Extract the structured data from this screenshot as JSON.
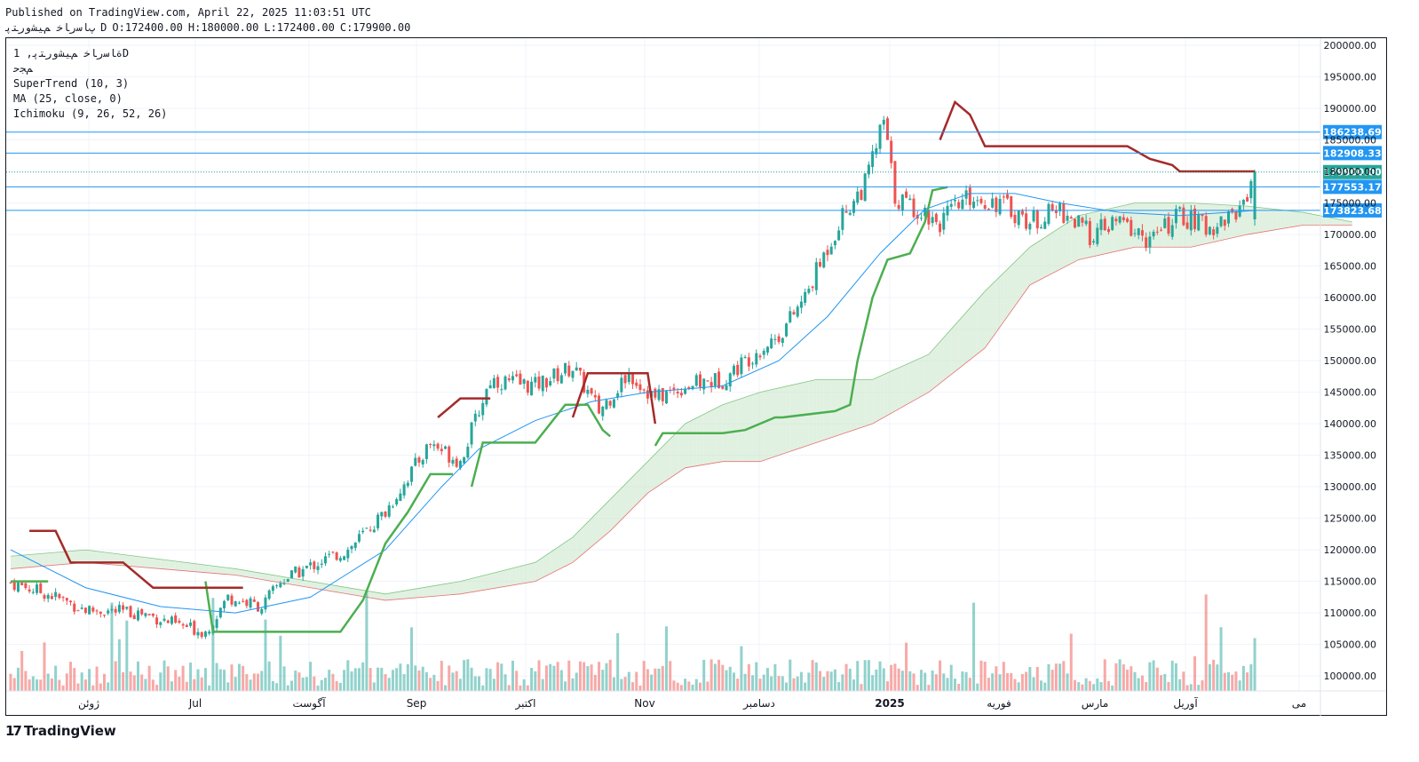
{
  "header": {
    "published": "Published on TradingView.com, April 22, 2025 11:03:51 UTC",
    "symbol": "ﭖﺎﺳﺭﺎﺧ ﻢﯿﺸﻭﺭﺘﭘ",
    "interval": "D",
    "ohlc": {
      "open": "O:172400.00",
      "high": "H:180000.00",
      "low": "L:172400.00",
      "close": "C:179900.00"
    }
  },
  "legend": {
    "title": "ﺓﺎﺳﺭﺎﺧ ﻢﯿﺸﻭﺭﺘﭘ, 1D",
    "subtitle": "ﻢﺠﺣ",
    "indicators": [
      "SuperTrend (10, 3)",
      "MA (25, close, 0)",
      "Ichimoku (9, 26, 52, 26)"
    ]
  },
  "logo": {
    "mark": "17",
    "text": "TradingView"
  },
  "colors": {
    "up": "#26a69a",
    "down": "#ef5350",
    "supertrend_up": "#4caf50",
    "supertrend_down": "#a52a2a",
    "ma": "#2196f3",
    "cloud_bull": "#c8e6c9",
    "cloud_bear": "#ffcdd2",
    "hline": "#2196f3",
    "price_label": "#2196f3",
    "last_price_label": "#26a69a"
  },
  "chart_data": {
    "type": "candlestick",
    "y_axis": {
      "min": 96500,
      "max": 200000,
      "ticks": [
        200000,
        195000,
        190000,
        185000,
        180000,
        175000,
        170000,
        165000,
        160000,
        155000,
        150000,
        145000,
        140000,
        135000,
        130000,
        125000,
        120000,
        115000,
        110000,
        105000,
        100000
      ],
      "tick_labels": [
        "200000.00",
        "195000.00",
        "190000.00",
        "185000.00",
        "180000.00",
        "175000.00",
        "170000.00",
        "165000.00",
        "160000.00",
        "155000.00",
        "150000.00",
        "145000.00",
        "140000.00",
        "135000.00",
        "130000.00",
        "125000.00",
        "120000.00",
        "115000.00",
        "110000.00",
        "105000.00",
        "100000.00"
      ]
    },
    "x_axis": {
      "labels": [
        "ژوئن",
        "Jul",
        "آگوست",
        "Sep",
        "اکتبر",
        "Nov",
        "دسامبر",
        "2025",
        "فوریه",
        "مارس",
        "آوریل",
        "می"
      ]
    },
    "horizontal_lines": [
      {
        "value": 186238.69,
        "label": "186238.69"
      },
      {
        "value": 182908.33,
        "label": "182908.33"
      },
      {
        "value": 177553.17,
        "label": "177553.17"
      },
      {
        "value": 173823.68,
        "label": "173823.68"
      }
    ],
    "last_price": {
      "value": 179900,
      "label": "179900.00"
    },
    "price_anchors": [
      {
        "i": 0,
        "c": 114800
      },
      {
        "i": 10,
        "c": 113000
      },
      {
        "i": 20,
        "c": 110500
      },
      {
        "i": 35,
        "c": 110000
      },
      {
        "i": 45,
        "c": 108000
      },
      {
        "i": 52,
        "c": 107000
      },
      {
        "i": 58,
        "c": 112500
      },
      {
        "i": 67,
        "c": 111000
      },
      {
        "i": 72,
        "c": 115000
      },
      {
        "i": 82,
        "c": 118000
      },
      {
        "i": 90,
        "c": 120000
      },
      {
        "i": 100,
        "c": 126000
      },
      {
        "i": 112,
        "c": 137000
      },
      {
        "i": 120,
        "c": 134000
      },
      {
        "i": 128,
        "c": 147000
      },
      {
        "i": 140,
        "c": 146000
      },
      {
        "i": 150,
        "c": 149000
      },
      {
        "i": 157,
        "c": 142000
      },
      {
        "i": 165,
        "c": 148000
      },
      {
        "i": 172,
        "c": 144000
      },
      {
        "i": 180,
        "c": 146000
      },
      {
        "i": 190,
        "c": 147000
      },
      {
        "i": 198,
        "c": 151000
      },
      {
        "i": 205,
        "c": 154000
      },
      {
        "i": 212,
        "c": 160000
      },
      {
        "i": 218,
        "c": 168000
      },
      {
        "i": 222,
        "c": 173000
      },
      {
        "i": 228,
        "c": 178000
      },
      {
        "i": 233,
        "c": 188000
      },
      {
        "i": 236,
        "c": 176000
      },
      {
        "i": 242,
        "c": 174000
      },
      {
        "i": 248,
        "c": 172000
      },
      {
        "i": 256,
        "c": 176000
      },
      {
        "i": 264,
        "c": 175000
      },
      {
        "i": 272,
        "c": 172000
      },
      {
        "i": 280,
        "c": 174000
      },
      {
        "i": 288,
        "c": 170000
      },
      {
        "i": 296,
        "c": 172000
      },
      {
        "i": 304,
        "c": 169000
      },
      {
        "i": 312,
        "c": 173000
      },
      {
        "i": 320,
        "c": 171000
      },
      {
        "i": 328,
        "c": 174000
      },
      {
        "i": 332,
        "c": 179900
      }
    ],
    "supertrend": {
      "up_segments": [
        [
          [
            0,
            115000
          ],
          [
            6,
            115000
          ],
          [
            10,
            115000
          ]
        ],
        [
          [
            52,
            115000
          ],
          [
            54,
            107000
          ],
          [
            88,
            107000
          ],
          [
            94,
            112000
          ],
          [
            100,
            121000
          ],
          [
            106,
            126000
          ],
          [
            112,
            132000
          ],
          [
            118,
            132000
          ]
        ],
        [
          [
            123,
            130000
          ],
          [
            126,
            137000
          ],
          [
            140,
            137000
          ],
          [
            148,
            143000
          ],
          [
            154,
            143000
          ],
          [
            158,
            139000
          ],
          [
            160,
            138000
          ]
        ],
        [
          [
            172,
            136500
          ],
          [
            174,
            138500
          ],
          [
            190,
            138500
          ],
          [
            196,
            139000
          ],
          [
            204,
            141000
          ],
          [
            206,
            141000
          ],
          [
            220,
            142000
          ],
          [
            224,
            143000
          ],
          [
            226,
            150000
          ],
          [
            230,
            160000
          ],
          [
            234,
            166000
          ],
          [
            240,
            167000
          ],
          [
            244,
            172000
          ],
          [
            246,
            177000
          ],
          [
            250,
            177500
          ]
        ]
      ],
      "down_segments": [
        [
          [
            5,
            123000
          ],
          [
            12,
            123000
          ],
          [
            16,
            118000
          ],
          [
            30,
            118000
          ],
          [
            38,
            114000
          ],
          [
            62,
            114000
          ]
        ],
        [
          [
            114,
            141000
          ],
          [
            120,
            144000
          ],
          [
            128,
            144000
          ]
        ],
        [
          [
            150,
            141000
          ],
          [
            154,
            148000
          ],
          [
            170,
            148000
          ],
          [
            172,
            140000
          ]
        ],
        [
          [
            248,
            185000
          ],
          [
            252,
            191000
          ],
          [
            256,
            189000
          ],
          [
            260,
            184000
          ],
          [
            298,
            184000
          ],
          [
            304,
            182000
          ],
          [
            310,
            181000
          ],
          [
            312,
            180000
          ],
          [
            332,
            180000
          ]
        ]
      ]
    },
    "ma": [
      [
        0,
        120000
      ],
      [
        20,
        114000
      ],
      [
        40,
        111000
      ],
      [
        60,
        110000
      ],
      [
        80,
        112500
      ],
      [
        100,
        120000
      ],
      [
        115,
        130000
      ],
      [
        125,
        136000
      ],
      [
        140,
        140500
      ],
      [
        155,
        143500
      ],
      [
        170,
        145000
      ],
      [
        190,
        146000
      ],
      [
        205,
        150000
      ],
      [
        218,
        157000
      ],
      [
        232,
        167000
      ],
      [
        244,
        174000
      ],
      [
        256,
        176500
      ],
      [
        268,
        176500
      ],
      [
        280,
        175000
      ],
      [
        296,
        173500
      ],
      [
        312,
        173000
      ],
      [
        332,
        173800
      ]
    ],
    "cloud": {
      "span_a": [
        [
          0,
          119000
        ],
        [
          20,
          120000
        ],
        [
          40,
          118500
        ],
        [
          60,
          117000
        ],
        [
          80,
          115000
        ],
        [
          100,
          113000
        ],
        [
          120,
          115000
        ],
        [
          140,
          118000
        ],
        [
          150,
          122000
        ],
        [
          160,
          128000
        ],
        [
          170,
          134000
        ],
        [
          180,
          140000
        ],
        [
          190,
          143000
        ],
        [
          200,
          145000
        ],
        [
          215,
          147000
        ],
        [
          230,
          147000
        ],
        [
          245,
          151000
        ],
        [
          260,
          161000
        ],
        [
          272,
          168000
        ],
        [
          285,
          173000
        ],
        [
          300,
          175000
        ],
        [
          315,
          175000
        ],
        [
          330,
          174500
        ],
        [
          345,
          173500
        ],
        [
          358,
          172000
        ]
      ],
      "span_b": [
        [
          0,
          117000
        ],
        [
          20,
          118000
        ],
        [
          40,
          117000
        ],
        [
          60,
          116000
        ],
        [
          80,
          114000
        ],
        [
          100,
          112000
        ],
        [
          120,
          113000
        ],
        [
          140,
          115000
        ],
        [
          150,
          118000
        ],
        [
          160,
          123000
        ],
        [
          170,
          129000
        ],
        [
          180,
          133000
        ],
        [
          190,
          134000
        ],
        [
          200,
          134000
        ],
        [
          215,
          137000
        ],
        [
          230,
          140000
        ],
        [
          245,
          145000
        ],
        [
          260,
          152000
        ],
        [
          272,
          162000
        ],
        [
          285,
          166000
        ],
        [
          300,
          168000
        ],
        [
          315,
          168000
        ],
        [
          330,
          170000
        ],
        [
          345,
          171500
        ],
        [
          358,
          171500
        ]
      ]
    },
    "volume_note": "volume bars shown at bottom, ~max 123000-equivalent height"
  }
}
